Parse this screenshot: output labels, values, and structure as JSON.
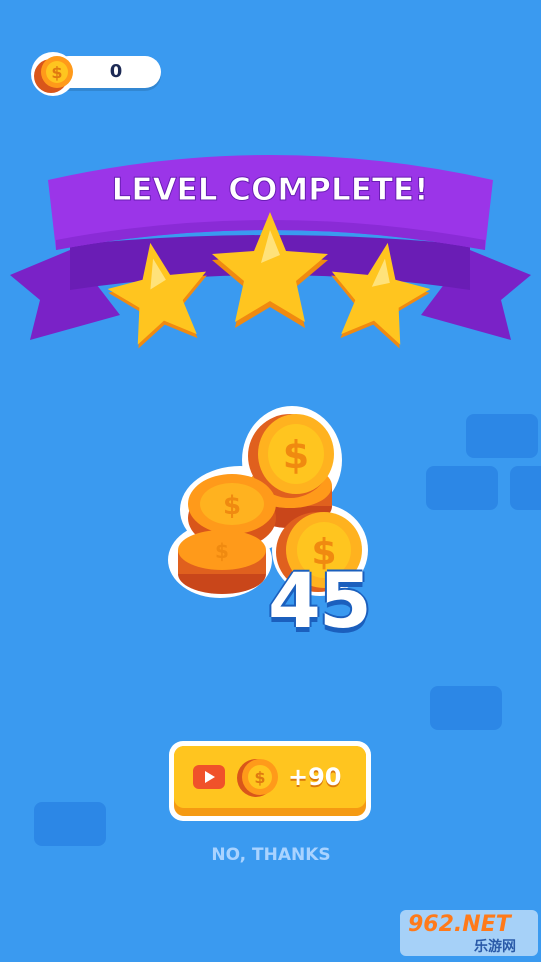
{
  "hud": {
    "coin_count": "0"
  },
  "banner": {
    "title": "LEVEL COMPLETE!",
    "stars_earned": 3,
    "stars_total": 3
  },
  "reward": {
    "amount": "45"
  },
  "watch_ad_button": {
    "label": "+90"
  },
  "no_thanks": {
    "label": "NO, THANKS"
  },
  "watermark": {
    "brand": "962.NET",
    "subtitle": "乐游网"
  },
  "colors": {
    "background": "#3a9af0",
    "ribbon": "#9b35e8",
    "star": "#ffc51f",
    "coin": "#ff9a1a",
    "button": "#ffc51f"
  }
}
